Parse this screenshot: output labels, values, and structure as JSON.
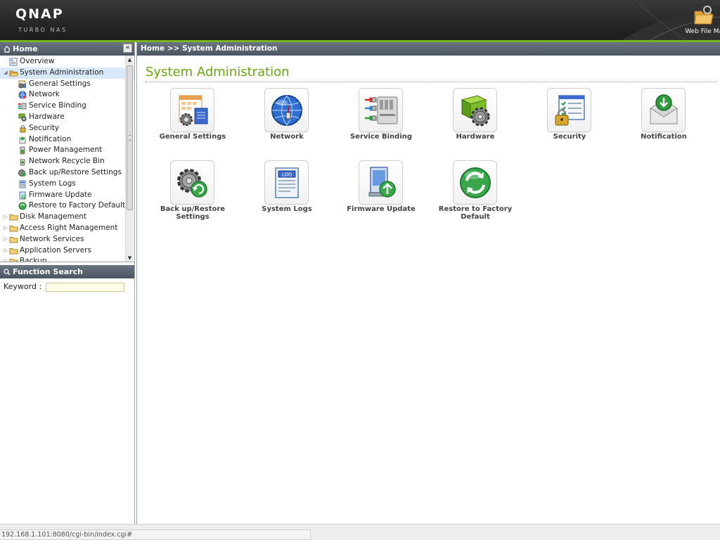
{
  "header": {
    "logo": "QNAP",
    "logo_sub": "TURBO NAS",
    "web_file_manager": "Web File Ma"
  },
  "sidebar": {
    "title": "Home",
    "collapse_glyph": "«",
    "tree": [
      {
        "label": "Overview",
        "level": 0,
        "icon": "overview-icon"
      },
      {
        "label": "System Administration",
        "level": 0,
        "icon": "folder-open-icon",
        "expanded": true,
        "selected": true
      },
      {
        "label": "General Settings",
        "level": 1,
        "icon": "general-settings-icon"
      },
      {
        "label": "Network",
        "level": 1,
        "icon": "network-icon"
      },
      {
        "label": "Service Binding",
        "level": 1,
        "icon": "service-binding-icon"
      },
      {
        "label": "Hardware",
        "level": 1,
        "icon": "hardware-icon"
      },
      {
        "label": "Security",
        "level": 1,
        "icon": "security-icon"
      },
      {
        "label": "Notification",
        "level": 1,
        "icon": "notification-icon"
      },
      {
        "label": "Power Management",
        "level": 1,
        "icon": "power-icon"
      },
      {
        "label": "Network Recycle Bin",
        "level": 1,
        "icon": "recycle-bin-icon"
      },
      {
        "label": "Back up/Restore Settings",
        "level": 1,
        "icon": "backup-icon"
      },
      {
        "label": "System Logs",
        "level": 1,
        "icon": "logs-icon"
      },
      {
        "label": "Firmware Update",
        "level": 1,
        "icon": "firmware-icon"
      },
      {
        "label": "Restore to Factory Default",
        "level": 1,
        "icon": "restore-icon"
      },
      {
        "label": "Disk Management",
        "level": 0,
        "icon": "folder-icon",
        "collapsed": true
      },
      {
        "label": "Access Right Management",
        "level": 0,
        "icon": "folder-icon",
        "collapsed": true
      },
      {
        "label": "Network Services",
        "level": 0,
        "icon": "folder-icon",
        "collapsed": true
      },
      {
        "label": "Application Servers",
        "level": 0,
        "icon": "folder-icon",
        "collapsed": true
      },
      {
        "label": "Backup",
        "level": 0,
        "icon": "folder-icon",
        "collapsed": true
      }
    ]
  },
  "function_search": {
    "title": "Function Search",
    "keyword_label": "Keyword :",
    "keyword_value": ""
  },
  "main": {
    "breadcrumb": "Home >> System Administration",
    "title": "System Administration",
    "tiles": [
      {
        "label": "General Settings",
        "icon": "general-settings-icon"
      },
      {
        "label": "Network",
        "icon": "network-globe-icon"
      },
      {
        "label": "Service Binding",
        "icon": "service-binding-icon"
      },
      {
        "label": "Hardware",
        "icon": "hardware-gear-icon"
      },
      {
        "label": "Security",
        "icon": "security-lock-icon"
      },
      {
        "label": "Notification",
        "icon": "notification-mail-icon"
      },
      {
        "label": "Back up/Restore Settings",
        "icon": "backup-restore-icon"
      },
      {
        "label": "System Logs",
        "icon": "system-logs-icon"
      },
      {
        "label": "Firmware Update",
        "icon": "firmware-update-icon"
      },
      {
        "label": "Restore to Factory Default",
        "icon": "restore-factory-icon"
      }
    ]
  },
  "status_bar": {
    "url": "192.168.1.101:8080/cgi-bin/index.cgi#"
  },
  "colors": {
    "accent_green": "#7ab51d",
    "title_green": "#6aa70e",
    "panel_header": "#5a6470",
    "selection": "#d9e8fb"
  }
}
